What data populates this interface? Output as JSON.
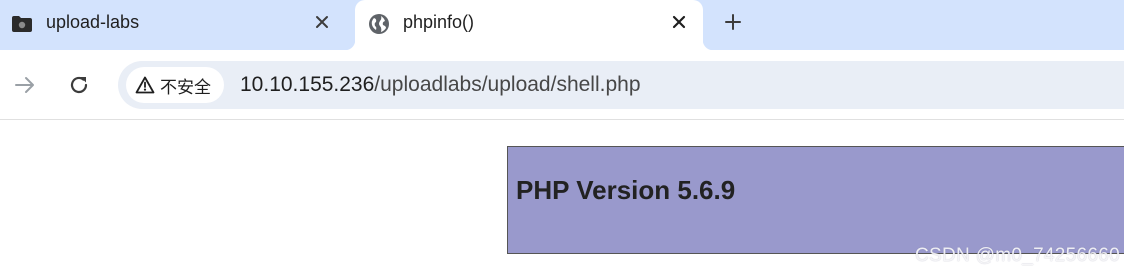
{
  "browser": {
    "tabs": [
      {
        "title": "upload-labs",
        "icon": "folder-icon",
        "active": false
      },
      {
        "title": "phpinfo()",
        "icon": "globe-icon",
        "active": true
      }
    ],
    "new_tab_icon": "plus-icon",
    "toolbar": {
      "security_label": "不安全",
      "url_host": "10.10.155.236",
      "url_path": "/uploadlabs/upload/shell.php"
    }
  },
  "page": {
    "header_title": "PHP Version 5.6.9",
    "header_bg": "#9999cc"
  },
  "watermark": "CSDN @m0_74256660"
}
